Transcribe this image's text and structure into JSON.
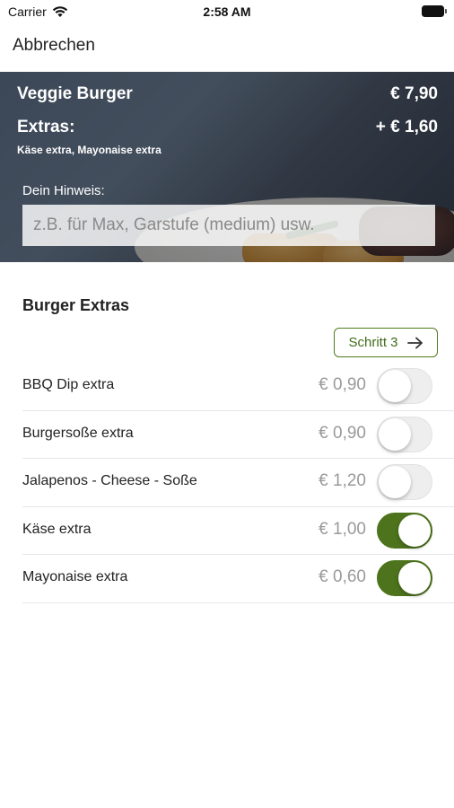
{
  "status_bar": {
    "carrier": "Carrier",
    "time": "2:58 AM"
  },
  "nav": {
    "cancel_label": "Abbrechen"
  },
  "product": {
    "name": "Veggie Burger",
    "price": "€ 7,90",
    "extras_label": "Extras:",
    "extras_price": "+ € 1,60",
    "extras_selected": "Käse extra, Mayonaise extra"
  },
  "hint": {
    "label": "Dein Hinweis:",
    "placeholder": "z.B. für Max, Garstufe (medium) usw."
  },
  "section": {
    "title": "Burger Extras",
    "step_label": "Schritt 3"
  },
  "extras": [
    {
      "label": "BBQ Dip extra",
      "price": "€ 0,90",
      "on": false
    },
    {
      "label": "Burgersoße extra",
      "price": "€ 0,90",
      "on": false
    },
    {
      "label": "Jalapenos - Cheese - Soße",
      "price": "€ 1,20",
      "on": false
    },
    {
      "label": "Käse extra",
      "price": "€ 1,00",
      "on": true
    },
    {
      "label": "Mayonaise extra",
      "price": "€ 0,60",
      "on": true
    }
  ],
  "colors": {
    "accent": "#4d731c",
    "toggle_off": "#eeeeee",
    "price_gray": "#9a9a9a"
  },
  "icons": {
    "wifi": "wifi-icon",
    "battery": "battery-icon",
    "step_arrow": "arrow-right-icon"
  }
}
